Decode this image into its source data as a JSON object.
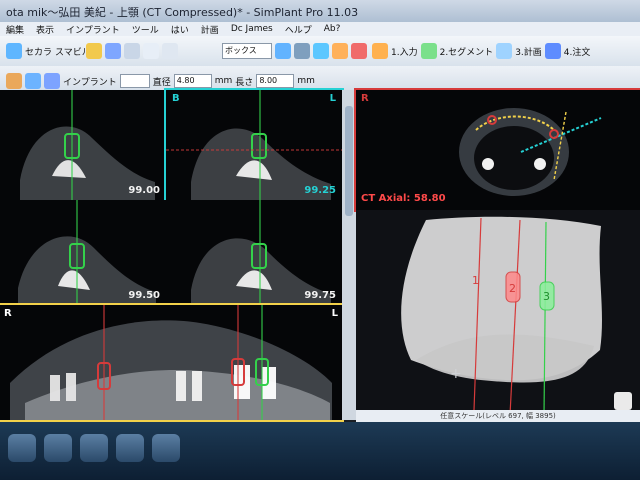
{
  "window": {
    "title": "ota mik～弘田 美紀 - 上顎 (CT Compressed)* - SimPlant Pro 11.03"
  },
  "menu": {
    "items": [
      "編集",
      "表示",
      "インプラント",
      "ツール",
      "はい",
      "計画",
      "Dc James",
      "ヘルプ",
      "Ab?"
    ]
  },
  "toolbar": {
    "left_label": "セカラ",
    "left_label2": "スマビル",
    "dropdown_value": "ボックス",
    "steps": [
      {
        "label": "1.入力"
      },
      {
        "label": "2.セグメント"
      },
      {
        "label": "3.計画"
      },
      {
        "label": "4.注文"
      }
    ]
  },
  "toolbar2": {
    "implant_label": "インプラント",
    "diameter_label": "直径",
    "diameter_value": "4.80",
    "diameter_unit": "mm",
    "length_label": "長さ",
    "length_value": "8.00",
    "length_unit": "mm"
  },
  "views": {
    "topleft_value": "99.00",
    "topright_value": "99.25",
    "bottomleft_value": "99.50",
    "bottomright_value": "99.75",
    "b_label": "B",
    "l_label": "L",
    "l2_label": "L",
    "r_label": "R",
    "axial_label": "R",
    "axial_caption": "CT Axial: 58.80",
    "pano_r": "R",
    "pano_l": "L"
  },
  "status": {
    "text": "任意スケール(レベル 697, 幅 3895)"
  },
  "colors": {
    "accent": "#d63b3b",
    "green": "#34d14b",
    "cyan": "#25d1d4"
  }
}
